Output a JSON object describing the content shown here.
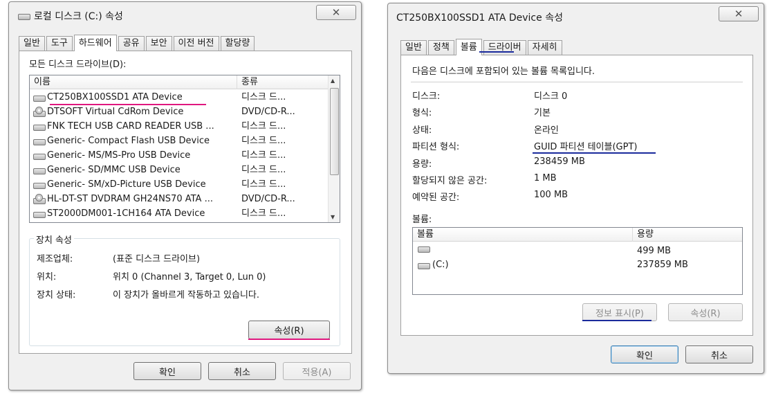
{
  "left_window": {
    "title": "로컬 디스크 (C:) 속성",
    "close_glyph": "✕",
    "tabs": [
      "일반",
      "도구",
      "하드웨어",
      "공유",
      "보안",
      "이전 버전",
      "할당량"
    ],
    "active_tab": "하드웨어",
    "list_label": "모든 디스크 드라이브(D):",
    "list_headers": [
      "이름",
      "종류"
    ],
    "devices": [
      {
        "name": "CT250BX100SSD1 ATA Device",
        "type": "디스크 드...",
        "icon": "drive-icon"
      },
      {
        "name": "DTSOFT Virtual CdRom Device",
        "type": "DVD/CD-R...",
        "icon": "cd-drive-icon"
      },
      {
        "name": "FNK TECH USB CARD READER USB ...",
        "type": "디스크 드...",
        "icon": "drive-icon"
      },
      {
        "name": "Generic- Compact Flash USB Device",
        "type": "디스크 드...",
        "icon": "drive-icon"
      },
      {
        "name": "Generic- MS/MS-Pro USB Device",
        "type": "디스크 드...",
        "icon": "drive-icon"
      },
      {
        "name": "Generic- SD/MMC USB Device",
        "type": "디스크 드...",
        "icon": "drive-icon"
      },
      {
        "name": "Generic- SM/xD-Picture USB Device",
        "type": "디스크 드...",
        "icon": "drive-icon"
      },
      {
        "name": "HL-DT-ST DVDRAM GH24NS70 ATA ...",
        "type": "DVD/CD-R...",
        "icon": "cd-drive-icon"
      },
      {
        "name": "ST2000DM001-1CH164 ATA Device",
        "type": "디스크 드...",
        "icon": "drive-icon"
      }
    ],
    "device_props": {
      "group_title": "장치 속성",
      "manufacturer_label": "제조업체:",
      "manufacturer_value": "(표준 디스크 드라이브)",
      "location_label": "위치:",
      "location_value": "위치 0 (Channel 3, Target 0, Lun 0)",
      "status_label": "장치 상태:",
      "status_value": "이 장치가 올바르게 작동하고 있습니다."
    },
    "properties_button": "속성(R)",
    "ok": "확인",
    "cancel": "취소",
    "apply": "적용(A)"
  },
  "right_window": {
    "title": "CT250BX100SSD1 ATA Device 속성",
    "close_glyph": "✕",
    "tabs": [
      "일반",
      "정책",
      "볼륨",
      "드라이버",
      "자세히"
    ],
    "active_tab": "볼륨",
    "description": "다음은 디스크에 포함되어 있는 볼륨 목록입니다.",
    "info": [
      {
        "label": "디스크:",
        "value": "디스크 0"
      },
      {
        "label": "형식:",
        "value": "기본"
      },
      {
        "label": "상태:",
        "value": "온라인"
      },
      {
        "label": "파티션 형식:",
        "value": "GUID 파티션 테이블(GPT)"
      },
      {
        "label": "용량:",
        "value": "238459 MB"
      },
      {
        "label": "할당되지 않은 공간:",
        "value": "1 MB"
      },
      {
        "label": "예약된 공간:",
        "value": "100 MB"
      }
    ],
    "volumes_label": "볼륨:",
    "volume_headers": [
      "볼륨",
      "용량"
    ],
    "volumes": [
      {
        "name": "",
        "size": "499 MB"
      },
      {
        "name": "(C:)",
        "size": "237859 MB"
      }
    ],
    "show_info_button": "정보 표시(P)",
    "properties_button": "속성(R)",
    "ok": "확인",
    "cancel": "취소"
  },
  "colors": {
    "annotation_magenta": "#e0177f",
    "annotation_blue": "#1a2a9c"
  }
}
